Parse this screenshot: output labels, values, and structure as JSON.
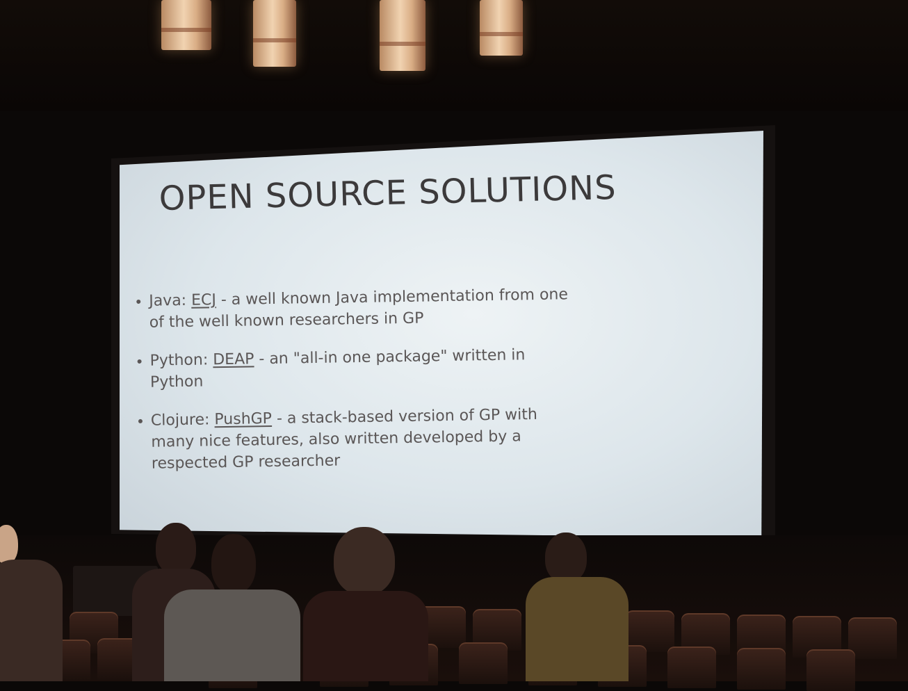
{
  "slide": {
    "title": "OPEN SOURCE SOLUTIONS",
    "bullets": [
      {
        "prefix": "Java: ",
        "link": "ECJ",
        "rest_line1": " - a well known Java implementation from one",
        "rest_line2": "of the well known researchers in GP"
      },
      {
        "prefix": "Python: ",
        "link": "DEAP",
        "rest_line1": " - an \"all-in one package\" written in",
        "rest_line2": "Python"
      },
      {
        "prefix": "Clojure: ",
        "link": "PushGP",
        "rest_line1": " - a stack-based version of GP with",
        "rest_line2": "many nice features, also written developed by a",
        "rest_line3": "respected GP researcher"
      }
    ]
  },
  "colors": {
    "screen": "#e4ebef",
    "slide_text": "#5a5656",
    "room": "#0b0807",
    "seats": "#3c231b"
  }
}
